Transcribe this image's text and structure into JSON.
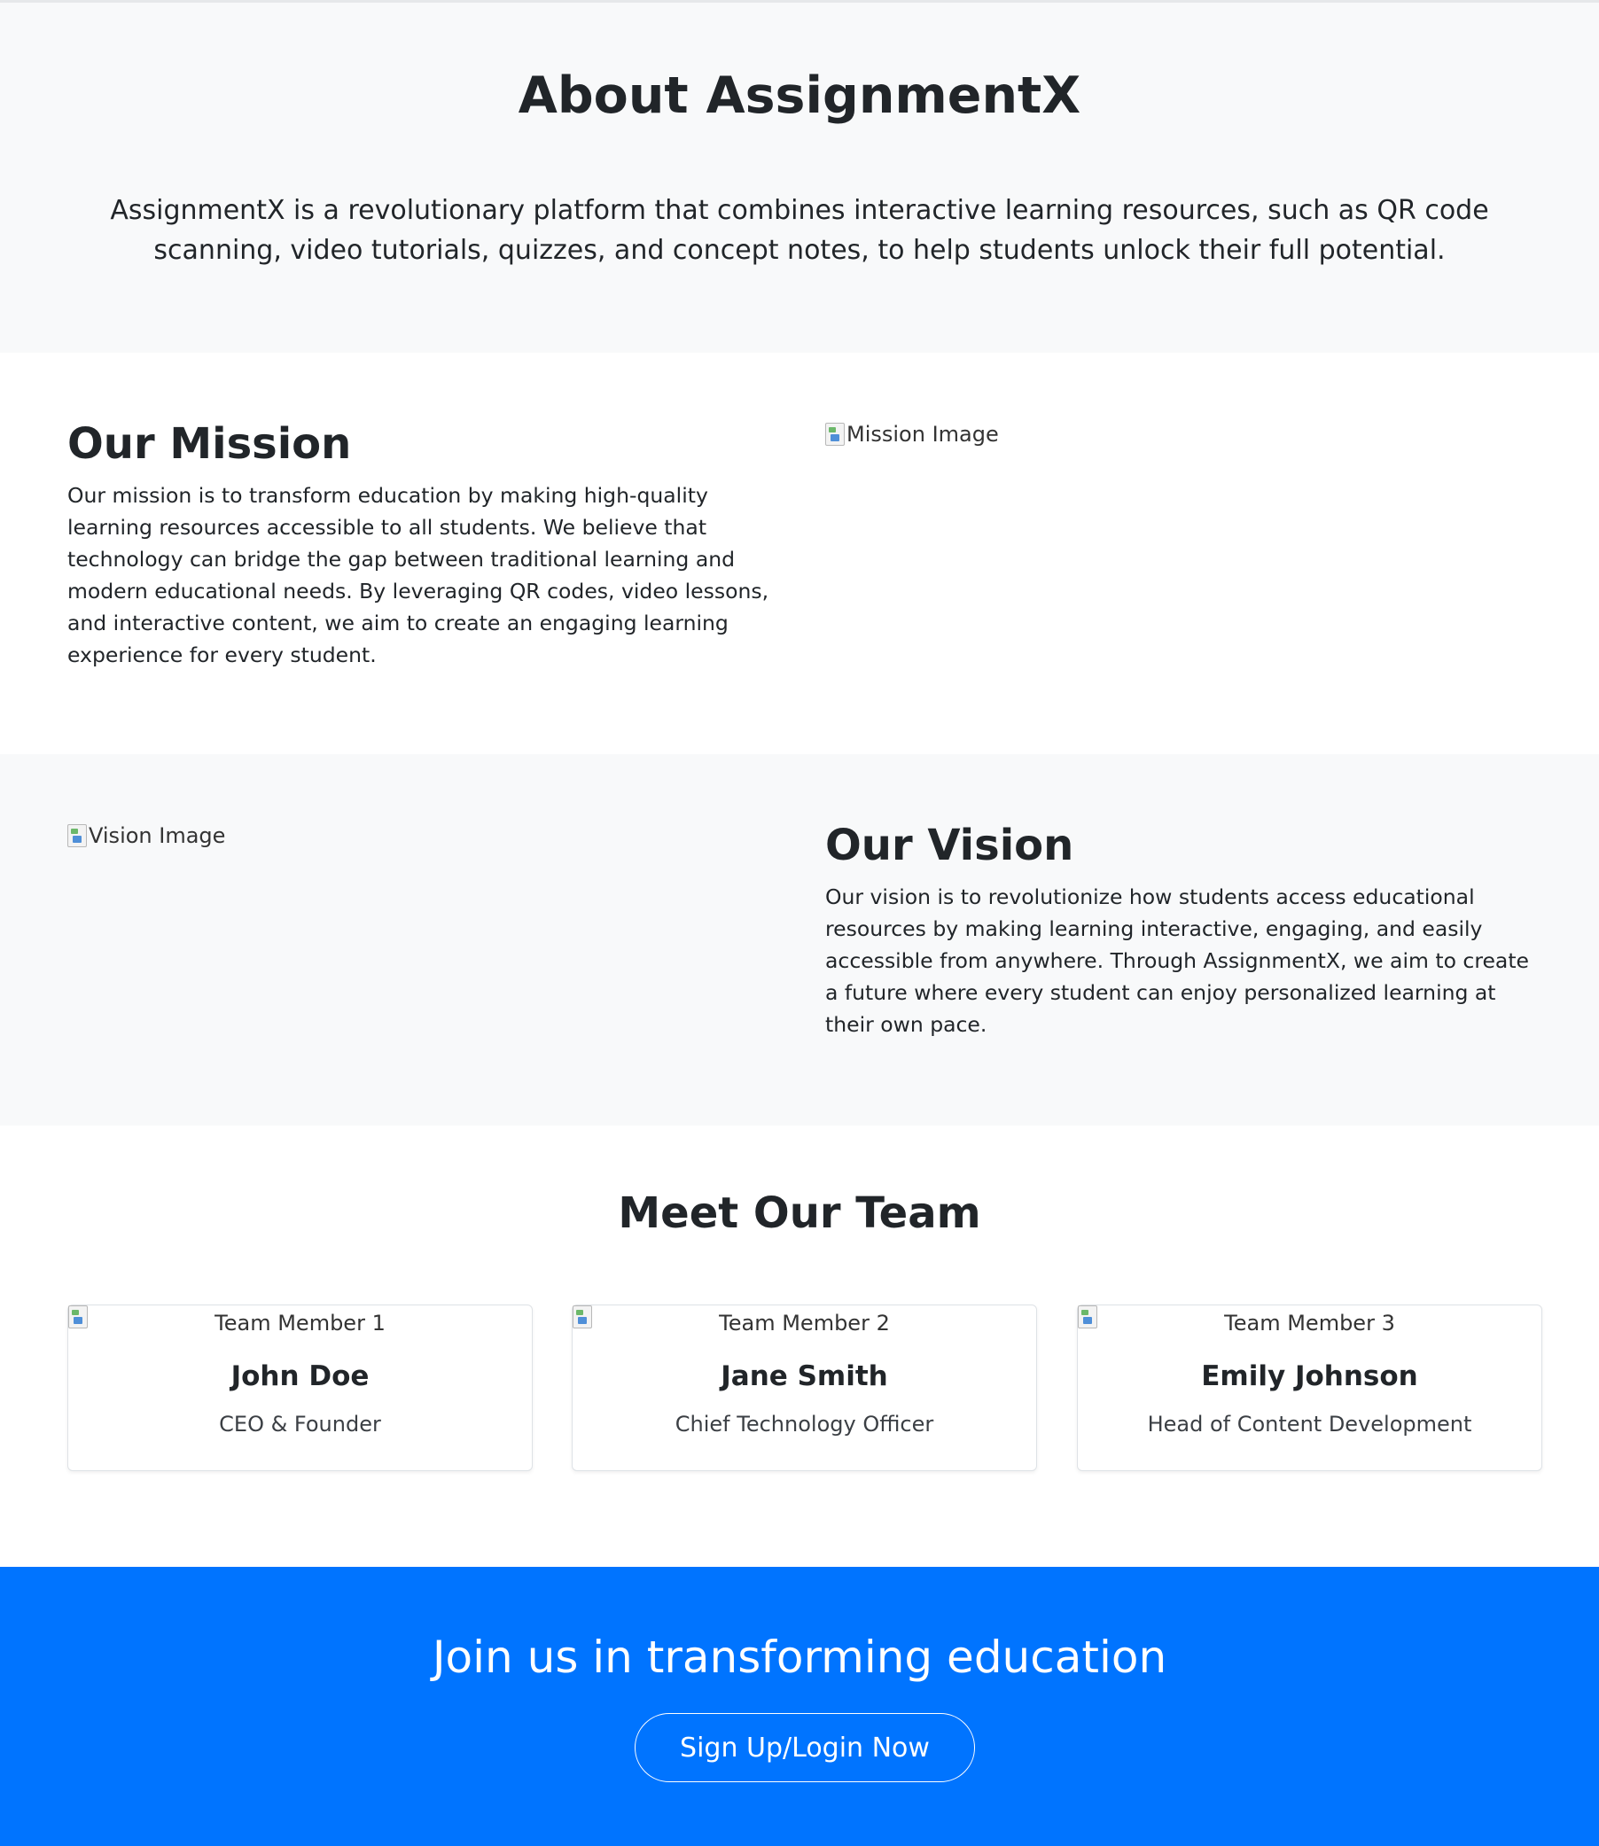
{
  "hero": {
    "title": "About AssignmentX",
    "description": "AssignmentX is a revolutionary platform that combines interactive learning resources, such as QR code scanning, video tutorials, quizzes, and concept notes, to help students unlock their full potential."
  },
  "mission": {
    "title": "Our Mission",
    "text": "Our mission is to transform education by making high-quality learning resources accessible to all students. We believe that technology can bridge the gap between traditional learning and modern educational needs. By leveraging QR codes, video lessons, and interactive content, we aim to create an engaging learning experience for every student.",
    "image_alt": "Mission Image"
  },
  "vision": {
    "title": "Our Vision",
    "text": "Our vision is to revolutionize how students access educational resources by making learning interactive, engaging, and easily accessible from anywhere. Through AssignmentX, we aim to create a future where every student can enjoy personalized learning at their own pace.",
    "image_alt": "Vision Image"
  },
  "team": {
    "title": "Meet Our Team",
    "members": [
      {
        "image_alt": "Team Member 1",
        "name": "John Doe",
        "role": "CEO & Founder"
      },
      {
        "image_alt": "Team Member 2",
        "name": "Jane Smith",
        "role": "Chief Technology Officer"
      },
      {
        "image_alt": "Team Member 3",
        "name": "Emily Johnson",
        "role": "Head of Content Development"
      }
    ]
  },
  "cta": {
    "title": "Join us in transforming education",
    "button_label": "Sign Up/Login Now"
  },
  "colors": {
    "primary": "#0074ff",
    "section_gray": "#f8f9fa",
    "text_dark": "#212529"
  }
}
